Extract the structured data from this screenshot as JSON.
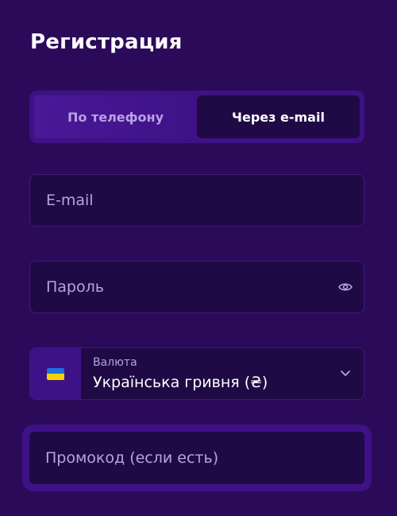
{
  "page": {
    "title": "Регистрация"
  },
  "tabs": [
    {
      "label": "По телефону",
      "active": false
    },
    {
      "label": "Через e-mail",
      "active": true
    }
  ],
  "email": {
    "placeholder": "E-mail"
  },
  "password": {
    "placeholder": "Пароль",
    "icon": "eye-icon"
  },
  "currency": {
    "label": "Валюта",
    "value": "Українська гривня (₴)",
    "flag": "ukraine-flag-icon",
    "icon": "chevron-down-icon"
  },
  "promo": {
    "placeholder": "Промокод (если есть)"
  },
  "colors": {
    "background": "#2c0a5a",
    "field_bg": "#1f0a45",
    "accent": "#3e1286",
    "placeholder": "#b9a3e3"
  }
}
